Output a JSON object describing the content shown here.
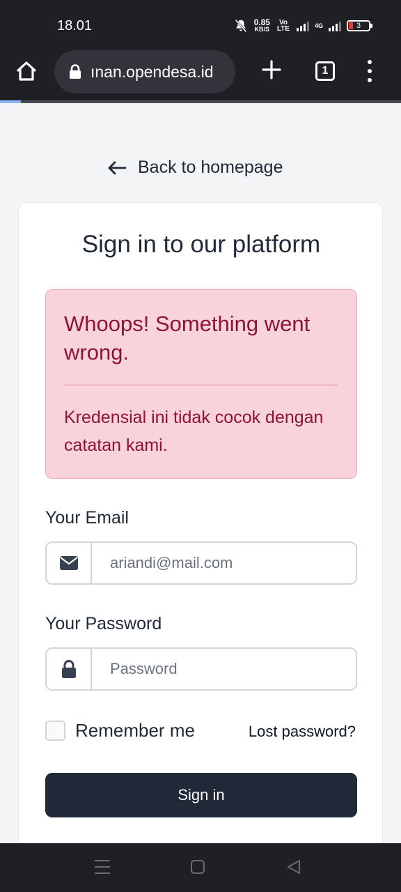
{
  "status_bar": {
    "time": "18.01",
    "net_speed": "0.85",
    "net_speed_unit": "KB/S",
    "volte": "Vo LTE",
    "network": "4G",
    "battery": "3"
  },
  "browser": {
    "url": "ınan.opendesa.id",
    "tab_count": "1"
  },
  "page": {
    "back_link": "Back to homepage",
    "title": "Sign in to our platform",
    "alert": {
      "heading": "Whoops! Something went wrong.",
      "message": "Kredensial ini tidak cocok dengan catatan kami."
    },
    "email": {
      "label": "Your Email",
      "placeholder": "ariandi@mail.com"
    },
    "password": {
      "label": "Your Password",
      "placeholder": "Password"
    },
    "remember_label": "Remember me",
    "lost_password": "Lost password?",
    "submit_label": "Sign in"
  },
  "colors": {
    "primary": "#1f2937",
    "alert_bg": "#f9d3da",
    "alert_text": "#8f1238",
    "page_bg": "#f3f4f6"
  }
}
